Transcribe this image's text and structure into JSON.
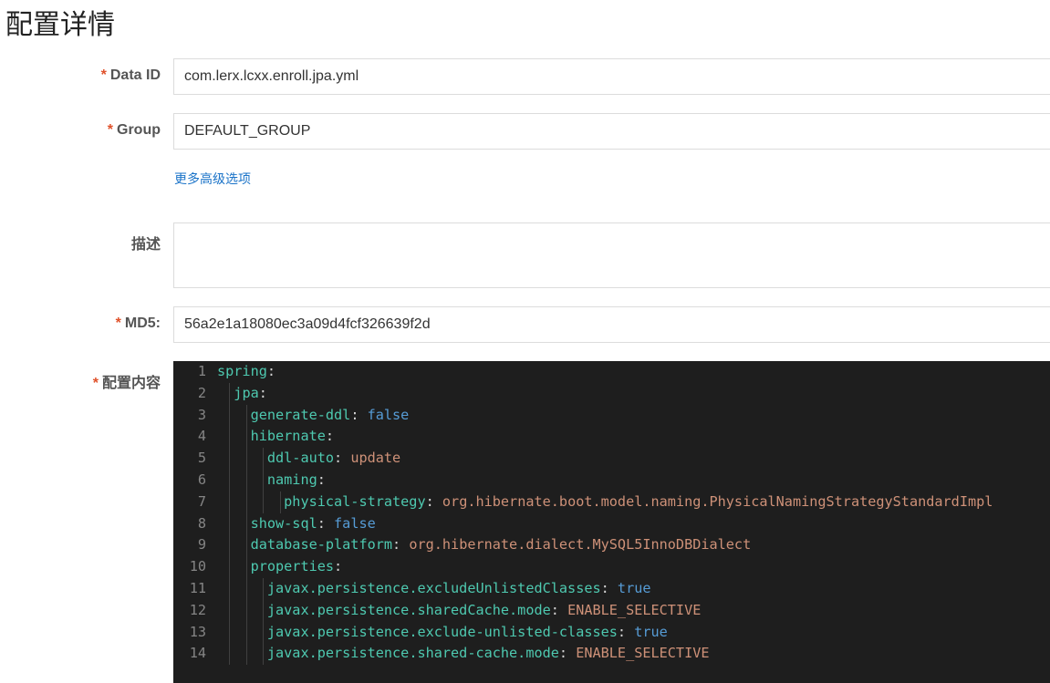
{
  "page": {
    "title": "配置详情"
  },
  "form": {
    "data_id": {
      "label": "Data ID",
      "value": "com.lerx.lcxx.enroll.jpa.yml",
      "required": true
    },
    "group": {
      "label": "Group",
      "value": "DEFAULT_GROUP",
      "required": true
    },
    "advanced_link": "更多高级选项",
    "description": {
      "label": "描述",
      "value": ""
    },
    "md5": {
      "label": "MD5:",
      "value": "56a2e1a18080ec3a09d4fcf326639f2d",
      "required": true
    },
    "content": {
      "label": "配置内容",
      "required": true
    },
    "required_mark": "*"
  },
  "editor": {
    "colors": {
      "background": "#1e1e1e",
      "key": "#4ec9b0",
      "boolean": "#569cd6",
      "string": "#ce9178",
      "line_number": "#858585"
    },
    "lines": [
      {
        "n": "1",
        "indent": 0,
        "key": "spring",
        "vtype": "",
        "value": ""
      },
      {
        "n": "2",
        "indent": 1,
        "key": "jpa",
        "vtype": "",
        "value": ""
      },
      {
        "n": "3",
        "indent": 2,
        "key": "generate-ddl",
        "vtype": "b",
        "value": "false"
      },
      {
        "n": "4",
        "indent": 2,
        "key": "hibernate",
        "vtype": "",
        "value": ""
      },
      {
        "n": "5",
        "indent": 3,
        "key": "ddl-auto",
        "vtype": "s",
        "value": "update"
      },
      {
        "n": "6",
        "indent": 3,
        "key": "naming",
        "vtype": "",
        "value": ""
      },
      {
        "n": "7",
        "indent": 4,
        "key": "physical-strategy",
        "vtype": "s",
        "value": "org.hibernate.boot.model.naming.PhysicalNamingStrategyStandardImpl"
      },
      {
        "n": "8",
        "indent": 2,
        "key": "show-sql",
        "vtype": "b",
        "value": "false"
      },
      {
        "n": "9",
        "indent": 2,
        "key": "database-platform",
        "vtype": "s",
        "value": "org.hibernate.dialect.MySQL5InnoDBDialect"
      },
      {
        "n": "10",
        "indent": 2,
        "key": "properties",
        "vtype": "",
        "value": ""
      },
      {
        "n": "11",
        "indent": 3,
        "key": "javax.persistence.excludeUnlistedClasses",
        "vtype": "b",
        "value": "true"
      },
      {
        "n": "12",
        "indent": 3,
        "key": "javax.persistence.sharedCache.mode",
        "vtype": "s",
        "value": "ENABLE_SELECTIVE"
      },
      {
        "n": "13",
        "indent": 3,
        "key": "javax.persistence.exclude-unlisted-classes",
        "vtype": "b",
        "value": "true"
      },
      {
        "n": "14",
        "indent": 3,
        "key": "javax.persistence.shared-cache.mode",
        "vtype": "s",
        "value": "ENABLE_SELECTIVE"
      }
    ]
  }
}
